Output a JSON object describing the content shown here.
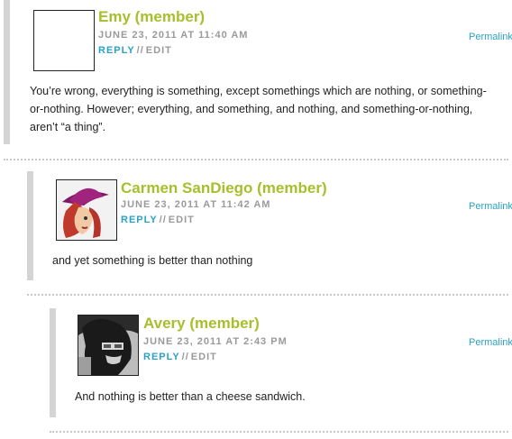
{
  "comments": [
    {
      "author": "Emy (member)",
      "date": "JUNE 23, 2011 AT 11:40 AM",
      "reply_label": "REPLY",
      "separator": "//",
      "edit_label": "EDIT",
      "permalink_label": "Permalink",
      "body": "You’re wrong, everything is something, except somethings which are nothing, or something-or-nothing. However; everything, and something, and nothing, and something-or-nothing, aren’t “a thing”.",
      "avatar_icon": "blank-avatar-icon"
    },
    {
      "author": "Carmen SanDiego (member)",
      "date": "JUNE 23, 2011 AT 11:42 AM",
      "reply_label": "REPLY",
      "separator": "//",
      "edit_label": "EDIT",
      "permalink_label": "Permalink",
      "body": "and yet something is better than nothing",
      "avatar_icon": "carmen-avatar-icon"
    },
    {
      "author": "Avery (member)",
      "date": "JUNE 23, 2011 AT 2:43 PM",
      "reply_label": "REPLY",
      "separator": "//",
      "edit_label": "EDIT",
      "permalink_label": "Permalink",
      "body": "And nothing is better than a cheese sandwich.",
      "avatar_icon": "avery-avatar-icon"
    }
  ],
  "colors": {
    "author": "#a7bf2b",
    "link": "#2aa2c6",
    "meta": "#9a9a9a",
    "bar": "#d4d4d4"
  }
}
